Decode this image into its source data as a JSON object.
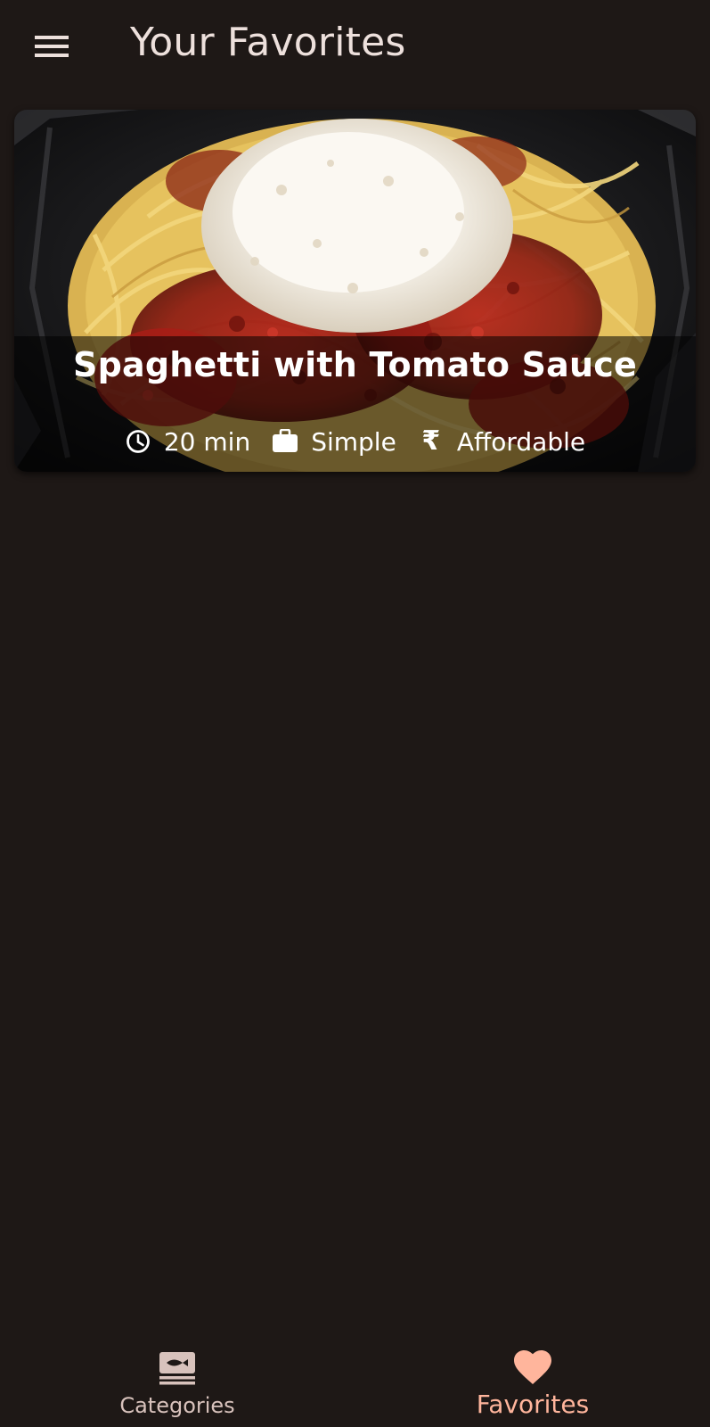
{
  "app_bar": {
    "menu_icon": "hamburger-menu-icon",
    "title": "Your Favorites"
  },
  "favorites": [
    {
      "title": "Spaghetti with Tomato Sauce",
      "duration": "20 min",
      "complexity": "Simple",
      "affordability": "Affordable",
      "icons": {
        "duration": "clock-icon",
        "complexity": "briefcase-icon",
        "affordability": "rupee-icon"
      }
    }
  ],
  "bottom_nav": {
    "items": [
      {
        "label": "Categories",
        "icon": "set-meal-icon",
        "active": false
      },
      {
        "label": "Favorites",
        "icon": "heart-icon",
        "active": true
      }
    ]
  },
  "colors": {
    "background": "#1e1816",
    "on_background": "#ede0dc",
    "accent": "#ffb59c",
    "inactive": "#d8c2bc"
  }
}
